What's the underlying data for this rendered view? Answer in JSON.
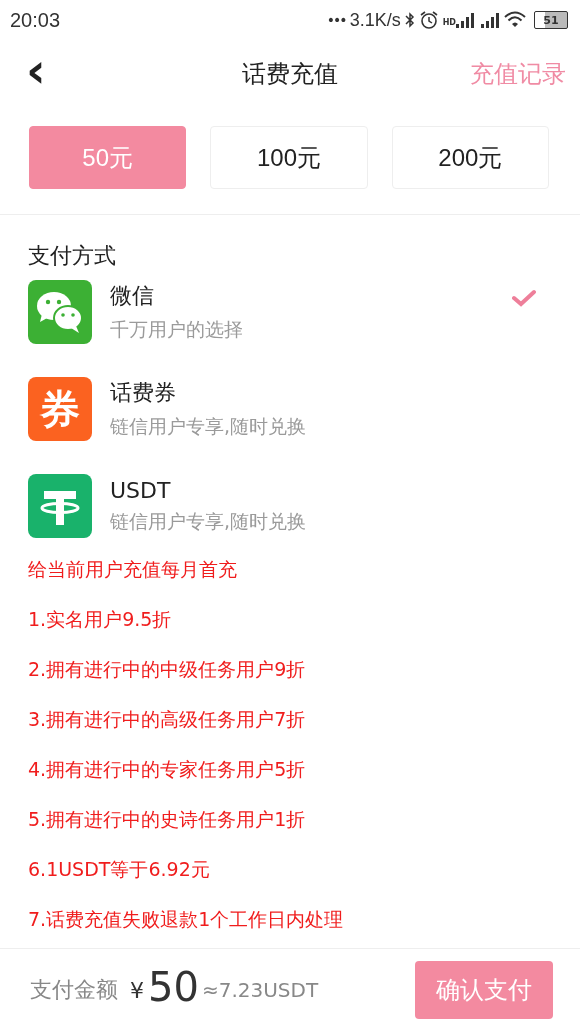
{
  "status_bar": {
    "time": "20:03",
    "dots": "•••",
    "speed": "3.1K/s",
    "hd": "HD",
    "battery": "51"
  },
  "nav": {
    "back": "‹",
    "title": "话费充值",
    "action": "充值记录"
  },
  "amounts": [
    {
      "label": "50元",
      "selected": true
    },
    {
      "label": "100元",
      "selected": false
    },
    {
      "label": "200元",
      "selected": false
    }
  ],
  "payment": {
    "heading": "支付方式",
    "methods": [
      {
        "kind": "wechat",
        "name": "微信",
        "desc": "千万用户的选择",
        "selected": true
      },
      {
        "kind": "coupon",
        "glyph": "券",
        "name": "话费券",
        "desc": "链信用户专享,随时兑换",
        "selected": false
      },
      {
        "kind": "tether",
        "name": "USDT",
        "desc": "链信用户专享,随时兑换",
        "selected": false
      }
    ]
  },
  "notes": [
    "给当前用户充值每月首充",
    "1.实名用户9.5折",
    "2.拥有进行中的中级任务用户9折",
    "3.拥有进行中的高级任务用户7折",
    "4.拥有进行中的专家任务用户5折",
    "5.拥有进行中的史诗任务用户1折",
    "6.1USDT等于6.92元",
    "7.话费充值失败退款1个工作日内处理"
  ],
  "footer": {
    "label": "支付金额",
    "currency": "¥",
    "amount": "50",
    "approx": "≈7.23USDT",
    "button": "确认支付"
  }
}
